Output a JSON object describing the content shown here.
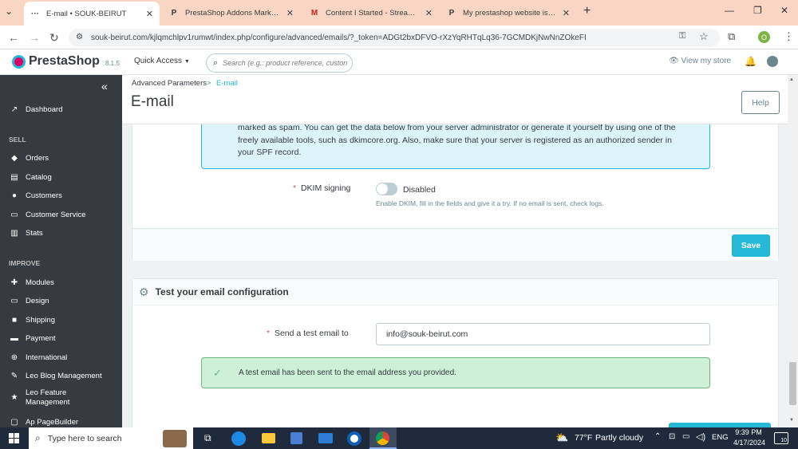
{
  "browser": {
    "tabs": [
      {
        "title": "E-mail • SOUK-BEIRUT",
        "favicon": "···"
      },
      {
        "title": "PrestaShop Addons Marketplace",
        "favicon": "P"
      },
      {
        "title": "Content I Started - Stream Sub",
        "favicon": "M"
      },
      {
        "title": "My prestashop website is not",
        "favicon": "P"
      }
    ],
    "url": "souk-beirut.com/kjlqmchlpv1rumwt/index.php/configure/advanced/emails/?_token=ADGt2bxDFVO-rXzYqRHTqLq36-7GCMDKjNwNnZOkeFI",
    "profile_initial": "O"
  },
  "header": {
    "logo": "PrestaShop",
    "version": "8.1.5",
    "quick_access": "Quick Access",
    "search_placeholder": "Search (e.g.: product reference, custon",
    "view_store": "View my store"
  },
  "sidebar": {
    "collapse": "«",
    "dashboard": "Dashboard",
    "sections": [
      {
        "title": "SELL",
        "items": [
          "Orders",
          "Catalog",
          "Customers",
          "Customer Service",
          "Stats"
        ]
      },
      {
        "title": "IMPROVE",
        "items": [
          "Modules",
          "Design",
          "Shipping",
          "Payment",
          "International",
          "Leo Blog Management",
          "Leo Feature Management",
          "Ap PageBuilder"
        ]
      }
    ]
  },
  "page": {
    "breadcrumb_parent": "Advanced Parameters",
    "breadcrumb_current": "E-mail",
    "title": "E-mail",
    "help": "Help"
  },
  "dkim": {
    "info_lines": [
      "marked as spam. You can get the data below from your server administrator or generate it yourself by using one of the",
      "freely available tools, such as dkimcore.org. Also, make sure that your server is registered as an authorized sender in",
      "your SPF record."
    ],
    "label": "DKIM signing",
    "state": "Disabled",
    "help": "Enable DKIM, fill in the fields and give it a try. If no email is sent, check logs.",
    "save": "Save"
  },
  "test": {
    "heading": "Test your email configuration",
    "label": "Send a test email to",
    "value": "info@souk-beirut.com",
    "success": "A test email has been sent to the email address you provided."
  },
  "taskbar": {
    "search": "Type here to search",
    "temp": "77°F",
    "weather": "Partly cloudy",
    "lang": "ENG",
    "time": "9:39 PM",
    "date": "4/17/2024",
    "notif_count": "10"
  }
}
